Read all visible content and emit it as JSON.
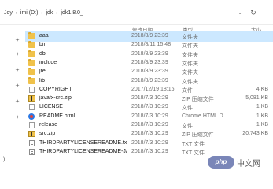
{
  "breadcrumb": [
    "Joy",
    "imi (D:)",
    "jdk",
    "jdk1.8.0_"
  ],
  "columns": {
    "date": "修改日期",
    "type": "类型",
    "size": "大小"
  },
  "files": [
    {
      "name": "aaa",
      "date": "2018/8/9 23:39",
      "type": "文件夹",
      "size": "",
      "icon": "folder-icon",
      "selected": true
    },
    {
      "name": "bin",
      "date": "2018/8/11 15:48",
      "type": "文件夹",
      "size": "",
      "icon": "folder-icon"
    },
    {
      "name": "db",
      "date": "2018/8/9 23:39",
      "type": "文件夹",
      "size": "",
      "icon": "folder-icon"
    },
    {
      "name": "include",
      "date": "2018/8/9 23:39",
      "type": "文件夹",
      "size": "",
      "icon": "folder-icon"
    },
    {
      "name": "jre",
      "date": "2018/8/9 23:39",
      "type": "文件夹",
      "size": "",
      "icon": "folder-icon"
    },
    {
      "name": "lib",
      "date": "2018/8/9 23:39",
      "type": "文件夹",
      "size": "",
      "icon": "folder-icon"
    },
    {
      "name": "COPYRIGHT",
      "date": "2017/12/19 18:16",
      "type": "文件",
      "size": "4 KB",
      "icon": "document-icon"
    },
    {
      "name": "javafx-src.zip",
      "date": "2018/7/3 10:29",
      "type": "ZIP 压缩文件",
      "size": "5,081 KB",
      "icon": "zip-icon"
    },
    {
      "name": "LICENSE",
      "date": "2018/7/3 10:29",
      "type": "文件",
      "size": "1 KB",
      "icon": "document-icon"
    },
    {
      "name": "README.html",
      "date": "2018/7/3 10:29",
      "type": "Chrome HTML D...",
      "size": "1 KB",
      "icon": "chrome-html-icon"
    },
    {
      "name": "release",
      "date": "2018/7/3 10:29",
      "type": "文件",
      "size": "1 KB",
      "icon": "document-icon"
    },
    {
      "name": "src.zip",
      "date": "2018/7/3 10:29",
      "type": "ZIP 压缩文件",
      "size": "20,743 KB",
      "icon": "zip-icon"
    },
    {
      "name": "THIRDPARTYLICENSEREADME.txt",
      "date": "2018/7/3 10:29",
      "type": "TXT 文件",
      "size": "",
      "icon": "text-file-icon"
    },
    {
      "name": "THIRDPARTYLICENSEREADME-JAVAF...",
      "date": "2018/7/3 10:29",
      "type": "TXT 文件",
      "size": "",
      "icon": "text-file-icon"
    }
  ],
  "status": ")",
  "watermark": {
    "logo": "php",
    "text": "中文网"
  }
}
